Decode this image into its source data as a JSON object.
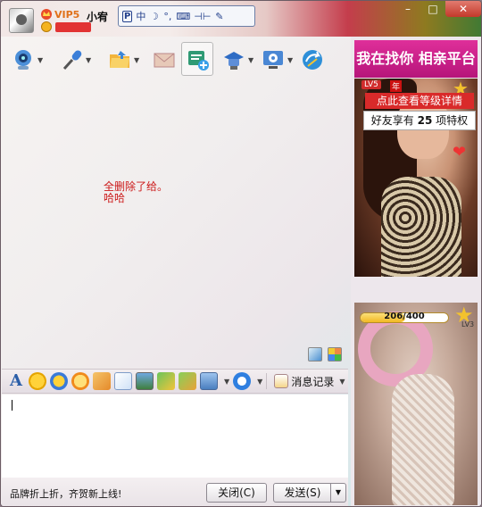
{
  "title_bar": {
    "vip_label": "VIP5",
    "nickname": "小宥",
    "ime_items": [
      "P",
      "中",
      "☽",
      "°,",
      "⌨",
      "⊣⊢",
      "✎"
    ],
    "window_buttons": [
      "–",
      "□",
      "✕"
    ]
  },
  "toolbar": {
    "items": [
      "video-call",
      "voice-call",
      "send-file",
      "send-email",
      "create-discussion",
      "app",
      "settings",
      "transfer"
    ]
  },
  "chat": {
    "message_lines": [
      "全删除了给。",
      "哈哈"
    ]
  },
  "format_bar": {
    "message_record_label": "消息记录"
  },
  "bottom": {
    "ad_text": "品牌折上折，齐贺新上线!",
    "close_label": "关闭(C)",
    "send_label": "发送(S)"
  },
  "right_panel": {
    "banner_text": "我在找你 相亲平台",
    "lv_label": "LV5",
    "year_label": "年",
    "tip_button": "点此查看等级详情",
    "tip_text_pre": "好友享有",
    "tip_count": "25",
    "tip_text_post": "项特权",
    "progress_text": "206/400",
    "progress_fraction": 0.515,
    "lv_small": "LV3"
  },
  "colors": {
    "banner": "#c51d89",
    "message": "#cc1a1a",
    "close_button": "#c3392b"
  }
}
